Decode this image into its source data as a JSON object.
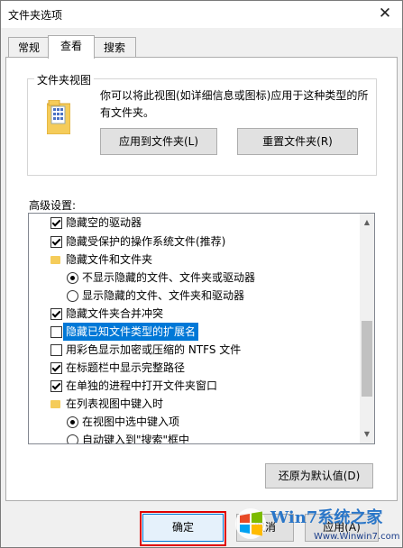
{
  "window": {
    "title": "文件夹选项",
    "close_glyph": "✕"
  },
  "tabs": [
    {
      "label": "常规"
    },
    {
      "label": "查看"
    },
    {
      "label": "搜索"
    }
  ],
  "active_tab": "查看",
  "folder_views": {
    "group_label": "文件夹视图",
    "description": "你可以将此视图(如详细信息或图标)应用于这种类型的所有文件夹。",
    "apply_button": "应用到文件夹(L)",
    "reset_button": "重置文件夹(R)"
  },
  "advanced": {
    "label": "高级设置:",
    "items": [
      {
        "type": "checkbox",
        "checked": true,
        "label": "隐藏空的驱动器"
      },
      {
        "type": "checkbox",
        "checked": true,
        "label": "隐藏受保护的操作系统文件(推荐)"
      },
      {
        "type": "folder",
        "label": "隐藏文件和文件夹"
      },
      {
        "type": "radio",
        "checked": true,
        "label": "不显示隐藏的文件、文件夹或驱动器"
      },
      {
        "type": "radio",
        "checked": false,
        "label": "显示隐藏的文件、文件夹和驱动器"
      },
      {
        "type": "checkbox",
        "checked": true,
        "label": "隐藏文件夹合并冲突"
      },
      {
        "type": "checkbox",
        "checked": false,
        "label": "隐藏已知文件类型的扩展名",
        "selected": true
      },
      {
        "type": "checkbox",
        "checked": false,
        "label": "用彩色显示加密或压缩的 NTFS 文件"
      },
      {
        "type": "checkbox",
        "checked": true,
        "label": "在标题栏中显示完整路径"
      },
      {
        "type": "checkbox",
        "checked": true,
        "label": "在单独的进程中打开文件夹窗口"
      },
      {
        "type": "folder",
        "label": "在列表视图中键入时"
      },
      {
        "type": "radio",
        "checked": true,
        "label": "在视图中选中键入项"
      },
      {
        "type": "radio",
        "checked": false,
        "label": "自动键入到\"搜索\"框中"
      }
    ],
    "scroll_up": "▲",
    "scroll_down": "▼"
  },
  "restore_button": "还原为默认值(D)",
  "footer": {
    "ok": "确定",
    "cancel": "取消",
    "apply": "应用(A)"
  },
  "watermark": {
    "name": "Win7系统之家",
    "url": "Www.Winwin7.com"
  }
}
